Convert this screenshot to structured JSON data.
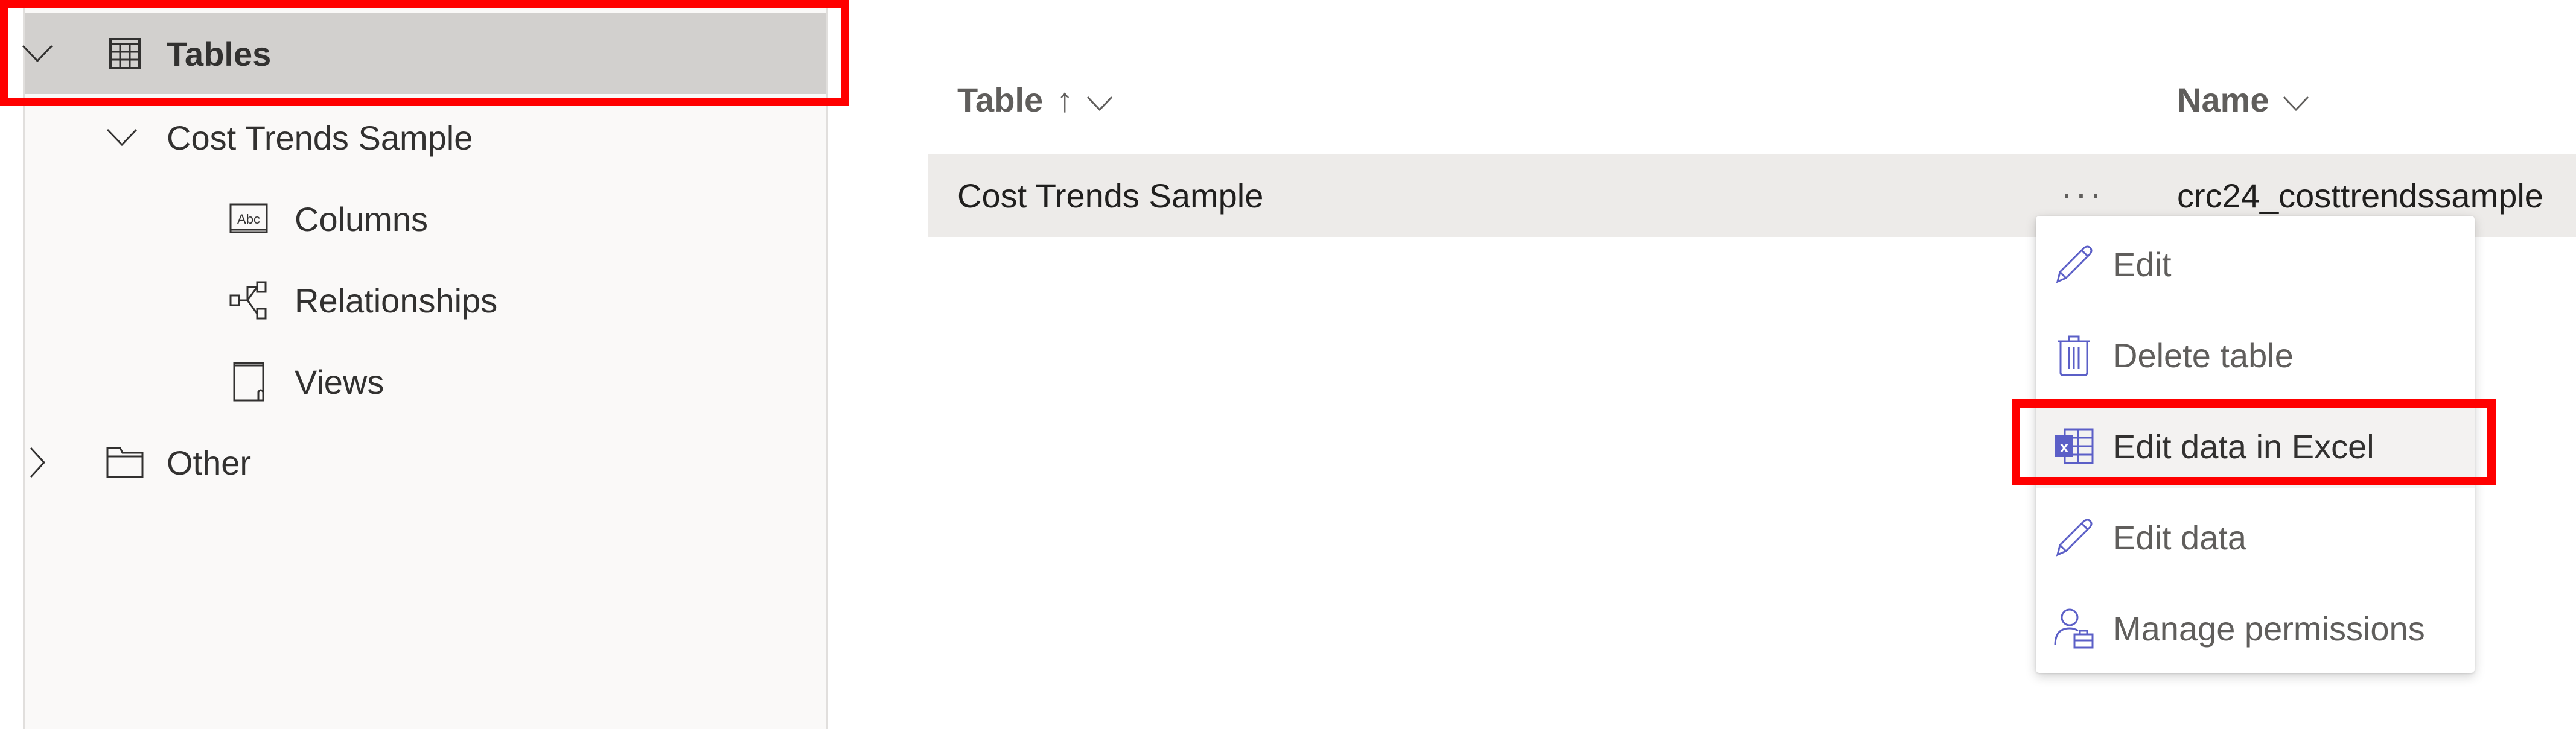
{
  "sidebar": {
    "tables": {
      "label": "Tables",
      "icon": "table-grid-icon",
      "expanded": true,
      "selected": true
    },
    "table_item": {
      "label": "Cost Trends Sample",
      "expanded": true
    },
    "children": [
      {
        "label": "Columns",
        "icon": "abc-column-icon"
      },
      {
        "label": "Relationships",
        "icon": "relationships-icon"
      },
      {
        "label": "Views",
        "icon": "view-icon"
      }
    ],
    "other": {
      "label": "Other",
      "icon": "folder-icon",
      "expanded": false
    }
  },
  "table": {
    "columns": [
      {
        "label": "Table",
        "sort": "ascending",
        "sort_icon": "↑"
      },
      {
        "label": "Name"
      }
    ],
    "rows": [
      {
        "table": "Cost Trends Sample",
        "name": "crc24_costtrendssample",
        "more_label": "···"
      }
    ]
  },
  "context_menu": {
    "items": [
      {
        "label": "Edit",
        "icon": "pencil-icon"
      },
      {
        "label": "Delete table",
        "icon": "trash-icon"
      },
      {
        "label": "Edit data in Excel",
        "icon": "excel-icon",
        "highlighted": true
      },
      {
        "label": "Edit data",
        "icon": "pencil-icon"
      },
      {
        "label": "Manage permissions",
        "icon": "person-briefcase-icon"
      }
    ]
  },
  "colors": {
    "accent_icon": "#5b5fc7",
    "highlight_box": "#ff0000",
    "selected_row": "#d2d0ce",
    "hover_row": "#edebe9"
  }
}
